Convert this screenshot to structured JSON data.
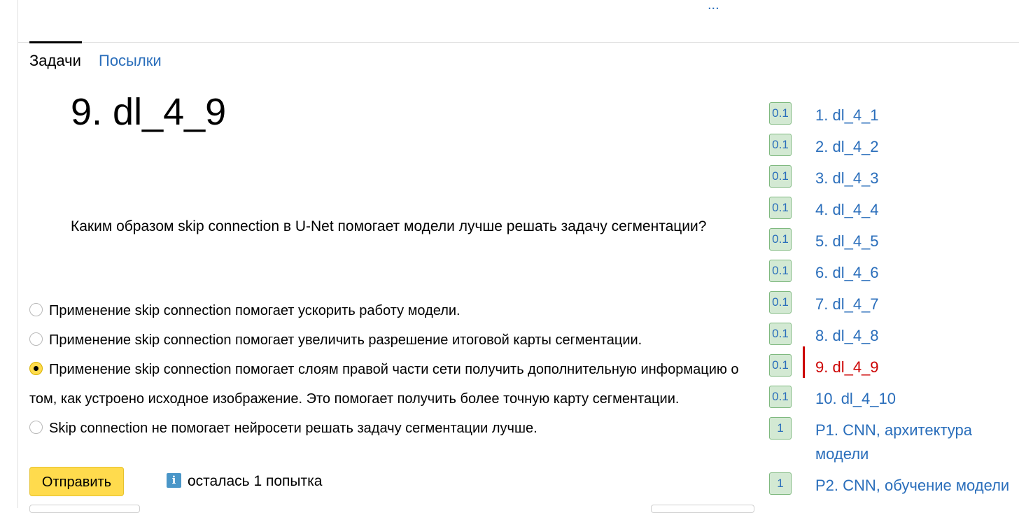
{
  "header": {
    "ellipsis": "..."
  },
  "tabs": [
    {
      "label": "Задачи",
      "active": true
    },
    {
      "label": "Посылки",
      "active": false
    }
  ],
  "task": {
    "title": "9. dl_4_9",
    "question": "Каким образом skip connection в U-Net помогает модели лучше решать задачу сегментации?",
    "options": [
      {
        "text": "Применение skip connection помогает ускорить работу модели.",
        "selected": false
      },
      {
        "text": "Применение skip connection помогает увеличить разрешение итоговой карты сегментации.",
        "selected": false
      },
      {
        "text": "Применение skip connection помогает слоям правой части сети получить дополнительную информацию о том, как устроено исходное изображение. Это помогает получить более точную карту сегментации.",
        "selected": true
      },
      {
        "text": "Skip connection не помогает нейросети решать задачу сегментации лучше.",
        "selected": false
      }
    ],
    "submit_label": "Отправить",
    "attempts_text": "осталась 1 попытка",
    "info_icon": "info-icon"
  },
  "sidebar": {
    "items": [
      {
        "score": "0.1",
        "label": "1. dl_4_1"
      },
      {
        "score": "0.1",
        "label": "2. dl_4_2"
      },
      {
        "score": "0.1",
        "label": "3. dl_4_3"
      },
      {
        "score": "0.1",
        "label": "4. dl_4_4"
      },
      {
        "score": "0.1",
        "label": "5. dl_4_5"
      },
      {
        "score": "0.1",
        "label": "6. dl_4_6"
      },
      {
        "score": "0.1",
        "label": "7. dl_4_7"
      },
      {
        "score": "0.1",
        "label": "8. dl_4_8"
      },
      {
        "score": "0.1",
        "label": "9. dl_4_9",
        "current": true
      },
      {
        "score": "0.1",
        "label": "10. dl_4_10"
      },
      {
        "score": "1",
        "label": "P1. CNN, архитектура модели"
      },
      {
        "score": "1",
        "label": "P2. CNN, обучение модели"
      }
    ]
  },
  "colors": {
    "link": "#2a6ebb",
    "current": "#cc0000",
    "submit_bg": "#ffdb4d",
    "score_bg": "#d3e9d3",
    "score_border": "#7fb97f"
  }
}
